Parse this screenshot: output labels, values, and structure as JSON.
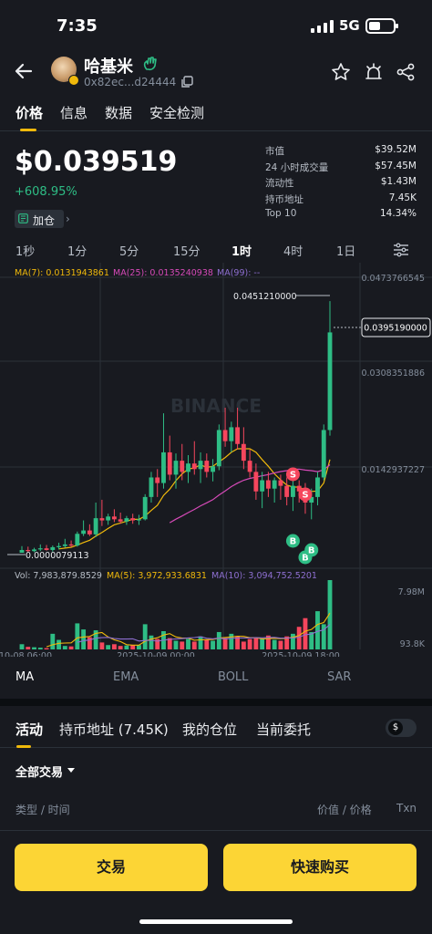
{
  "status_bar": {
    "time": "7:35",
    "network": "5G"
  },
  "header": {
    "token_name": "哈基米",
    "token_address": "0x82ec...d24444"
  },
  "tabs": [
    "价格",
    "信息",
    "数据",
    "安全检测"
  ],
  "price_panel": {
    "price": "$0.039519",
    "change": "+608.95%",
    "watchlist_label": "加仓"
  },
  "stats": [
    {
      "label": "市值",
      "value": "$39.52M"
    },
    {
      "label": "24 小时成交量",
      "value": "$57.45M"
    },
    {
      "label": "流动性",
      "value": "$1.43M"
    },
    {
      "label": "持币地址",
      "value": "7.45K"
    },
    {
      "label": "Top 10",
      "value": "14.34%"
    }
  ],
  "intervals": [
    "1秒",
    "1分",
    "5分",
    "15分",
    "1时",
    "4时",
    "1日"
  ],
  "active_interval": "1时",
  "chart_data": {
    "type": "candlestick",
    "ma_legend": {
      "ma7": "MA(7): 0.0131943861",
      "ma25": "MA(25): 0.0135240938",
      "ma99": "MA(99): --"
    },
    "y_ticks": [
      "0.0473766545",
      "0.0308351886",
      "0.0142937227"
    ],
    "high_label": "0.0451210000",
    "low_label": "0.0000079113",
    "last_price_label": "0.0395190000",
    "watermark": "BINANCE",
    "volume_legend": {
      "vol": "Vol: 7,983,879.8529",
      "ma5": "MA(5): 3,972,933.6831",
      "ma10": "MA(10): 3,094,752.5201"
    },
    "volume_ticks": [
      "7.98M",
      "93.8K"
    ],
    "x_ticks": [
      "10-08 06:00",
      "2025-10-09 00:00",
      "2025-10-09 18:00"
    ],
    "trade_markers": [
      "S",
      "S",
      "B",
      "B",
      "B"
    ],
    "colors": {
      "up": "#2ebd85",
      "down": "#f6465d",
      "ma7": "#f0b90b",
      "ma25": "#d64ab8",
      "ma99": "#8e6fd1"
    },
    "candles": [
      {
        "o": 7.9e-06,
        "h": 0.0012,
        "l": 7.9e-06,
        "c": 0.0005,
        "v": 0.6
      },
      {
        "o": 0.0005,
        "h": 0.0011,
        "l": 0.0001,
        "c": 0.0003,
        "v": 0.3
      },
      {
        "o": 0.0003,
        "h": 0.0009,
        "l": 0.0001,
        "c": 0.0006,
        "v": 0.25
      },
      {
        "o": 0.0006,
        "h": 0.0015,
        "l": 0.0003,
        "c": 0.0008,
        "v": 0.2
      },
      {
        "o": 0.0008,
        "h": 0.0014,
        "l": 0.0004,
        "c": 0.0005,
        "v": 0.15
      },
      {
        "o": 0.0005,
        "h": 0.0013,
        "l": 0.0002,
        "c": 0.001,
        "v": 1.8
      },
      {
        "o": 0.001,
        "h": 0.0018,
        "l": 0.0006,
        "c": 0.0012,
        "v": 1.1
      },
      {
        "o": 0.0012,
        "h": 0.0025,
        "l": 0.0009,
        "c": 0.0015,
        "v": 0.4
      },
      {
        "o": 0.0015,
        "h": 0.0022,
        "l": 0.001,
        "c": 0.0013,
        "v": 0.35
      },
      {
        "o": 0.0013,
        "h": 0.0038,
        "l": 0.0011,
        "c": 0.0034,
        "v": 3.0
      },
      {
        "o": 0.0034,
        "h": 0.0058,
        "l": 0.003,
        "c": 0.004,
        "v": 2.3
      },
      {
        "o": 0.004,
        "h": 0.0051,
        "l": 0.003,
        "c": 0.0033,
        "v": 1.4
      },
      {
        "o": 0.0033,
        "h": 0.009,
        "l": 0.0028,
        "c": 0.0062,
        "v": 2.2
      },
      {
        "o": 0.0062,
        "h": 0.0095,
        "l": 0.0048,
        "c": 0.0058,
        "v": 0.8
      },
      {
        "o": 0.0058,
        "h": 0.007,
        "l": 0.005,
        "c": 0.0065,
        "v": 0.5
      },
      {
        "o": 0.0065,
        "h": 0.0078,
        "l": 0.0055,
        "c": 0.006,
        "v": 0.6
      },
      {
        "o": 0.006,
        "h": 0.0072,
        "l": 0.0052,
        "c": 0.0056,
        "v": 0.4
      },
      {
        "o": 0.0056,
        "h": 0.0066,
        "l": 0.005,
        "c": 0.0062,
        "v": 0.45
      },
      {
        "o": 0.0062,
        "h": 0.007,
        "l": 0.0052,
        "c": 0.0058,
        "v": 0.5
      },
      {
        "o": 0.0058,
        "h": 0.0068,
        "l": 0.005,
        "c": 0.006,
        "v": 0.5
      },
      {
        "o": 0.006,
        "h": 0.0105,
        "l": 0.0058,
        "c": 0.01,
        "v": 2.9
      },
      {
        "o": 0.01,
        "h": 0.0145,
        "l": 0.009,
        "c": 0.0135,
        "v": 1.6
      },
      {
        "o": 0.0135,
        "h": 0.015,
        "l": 0.01,
        "c": 0.0125,
        "v": 1.2
      },
      {
        "o": 0.0125,
        "h": 0.025,
        "l": 0.0115,
        "c": 0.018,
        "v": 2.1
      },
      {
        "o": 0.018,
        "h": 0.021,
        "l": 0.013,
        "c": 0.014,
        "v": 1.3
      },
      {
        "o": 0.014,
        "h": 0.0178,
        "l": 0.0115,
        "c": 0.0165,
        "v": 1.0
      },
      {
        "o": 0.0165,
        "h": 0.0195,
        "l": 0.013,
        "c": 0.0145,
        "v": 0.9
      },
      {
        "o": 0.0145,
        "h": 0.0175,
        "l": 0.0125,
        "c": 0.016,
        "v": 1.2
      },
      {
        "o": 0.016,
        "h": 0.02,
        "l": 0.014,
        "c": 0.015,
        "v": 0.9
      },
      {
        "o": 0.015,
        "h": 0.018,
        "l": 0.0125,
        "c": 0.0165,
        "v": 1.5
      },
      {
        "o": 0.0165,
        "h": 0.0178,
        "l": 0.0135,
        "c": 0.0145,
        "v": 1.1
      },
      {
        "o": 0.0145,
        "h": 0.0168,
        "l": 0.0128,
        "c": 0.0155,
        "v": 1.0
      },
      {
        "o": 0.0155,
        "h": 0.023,
        "l": 0.0148,
        "c": 0.022,
        "v": 2.0
      },
      {
        "o": 0.022,
        "h": 0.026,
        "l": 0.019,
        "c": 0.02,
        "v": 1.3
      },
      {
        "o": 0.02,
        "h": 0.0235,
        "l": 0.018,
        "c": 0.0225,
        "v": 1.8
      },
      {
        "o": 0.0225,
        "h": 0.026,
        "l": 0.0185,
        "c": 0.0195,
        "v": 1.5
      },
      {
        "o": 0.0195,
        "h": 0.0225,
        "l": 0.015,
        "c": 0.0165,
        "v": 0.9
      },
      {
        "o": 0.0165,
        "h": 0.0185,
        "l": 0.0135,
        "c": 0.0145,
        "v": 1.2
      },
      {
        "o": 0.0145,
        "h": 0.016,
        "l": 0.0095,
        "c": 0.011,
        "v": 1.3
      },
      {
        "o": 0.011,
        "h": 0.0145,
        "l": 0.008,
        "c": 0.013,
        "v": 1.2
      },
      {
        "o": 0.013,
        "h": 0.0145,
        "l": 0.01,
        "c": 0.0115,
        "v": 1.6
      },
      {
        "o": 0.0115,
        "h": 0.0135,
        "l": 0.009,
        "c": 0.013,
        "v": 1.1
      },
      {
        "o": 0.013,
        "h": 0.014,
        "l": 0.0095,
        "c": 0.012,
        "v": 1.0
      },
      {
        "o": 0.012,
        "h": 0.0135,
        "l": 0.0085,
        "c": 0.01,
        "v": 1.5
      },
      {
        "o": 0.01,
        "h": 0.013,
        "l": 0.0075,
        "c": 0.012,
        "v": 1.8
      },
      {
        "o": 0.012,
        "h": 0.013,
        "l": 0.009,
        "c": 0.011,
        "v": 2.6
      },
      {
        "o": 0.011,
        "h": 0.0125,
        "l": 0.007,
        "c": 0.009,
        "v": 3.6
      },
      {
        "o": 0.009,
        "h": 0.0115,
        "l": 0.006,
        "c": 0.01,
        "v": 2.0
      },
      {
        "o": 0.01,
        "h": 0.0145,
        "l": 0.0085,
        "c": 0.0135,
        "v": 4.4
      },
      {
        "o": 0.0135,
        "h": 0.023,
        "l": 0.013,
        "c": 0.022,
        "v": 2.9
      },
      {
        "o": 0.022,
        "h": 0.0451,
        "l": 0.021,
        "c": 0.0395,
        "v": 7.98
      }
    ]
  },
  "indicators": [
    "MA",
    "EMA",
    "BOLL",
    "SAR"
  ],
  "activity_tabs": [
    "活动",
    "持币地址 (7.45K)",
    "我的仓位",
    "当前委托"
  ],
  "currency_toggle": "$",
  "filter_label": "全部交易",
  "list_columns": {
    "type_time": "类型 / 时间",
    "value_price": "价值 / 价格",
    "txn": "Txn"
  },
  "buttons": {
    "trade": "交易",
    "quick_buy": "快速购买"
  }
}
